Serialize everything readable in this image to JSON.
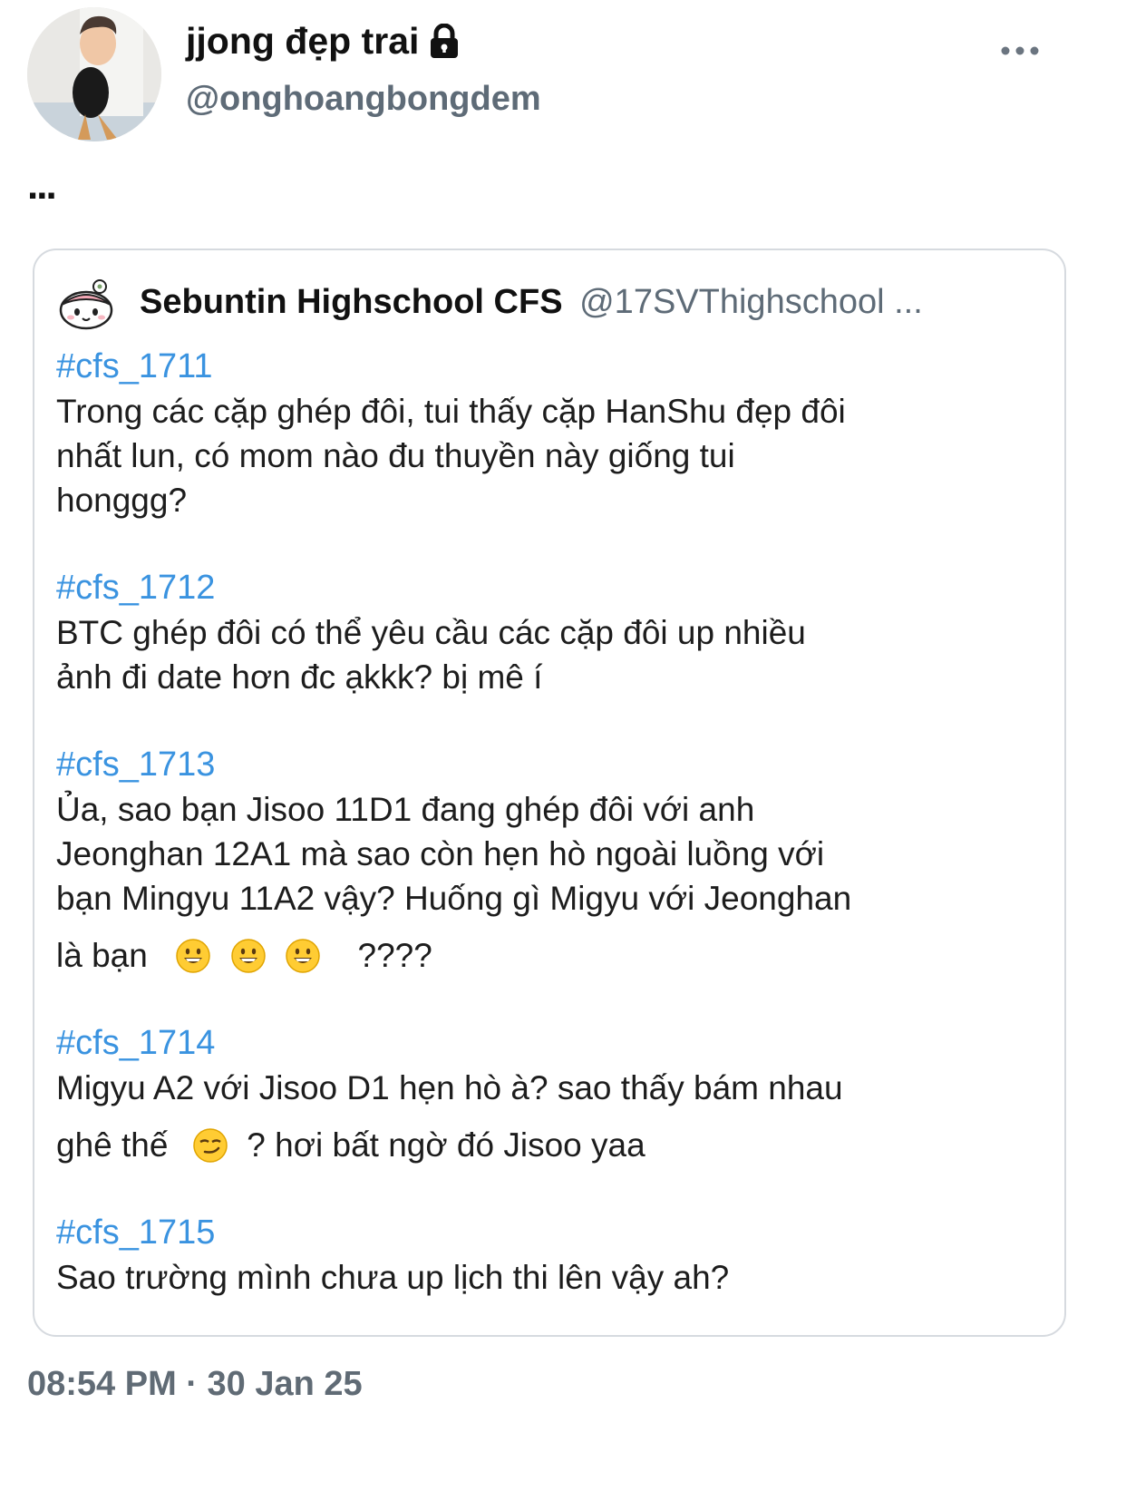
{
  "tweet": {
    "display_name": "jjong đẹp trai",
    "handle": "@onghoangbongdem",
    "text": "...",
    "timestamp": "08:54 PM · 30 Jan 25",
    "avatar_icon": "profile-photo-icon",
    "lock_icon": "lock-icon",
    "more_icon": "more-dots-icon"
  },
  "quote": {
    "display_name": "Sebuntin Highschool CFS",
    "handle": "@17SVThighschool ...",
    "avatar_icon": "cartoon-face-icon",
    "entries": [
      {
        "tag": "#cfs_1711",
        "lines": [
          "Trong các cặp ghép đôi, tui thấy cặp HanShu đẹp đôi",
          "nhất lun, có mom nào đu thuyền này giống tui",
          "honggg?"
        ]
      },
      {
        "tag": "#cfs_1712",
        "lines": [
          "BTC ghép đôi có thể yêu cầu các cặp đôi up nhiều",
          "ảnh đi date hơn đc ạkkk? bị mê í"
        ]
      },
      {
        "tag": "#cfs_1713",
        "lines": [
          "Ủa, sao bạn Jisoo 11D1 đang ghép đôi với anh",
          "Jeonghan 12A1 mà sao còn hẹn hò ngoài luồng với",
          "bạn Mingyu 11A2 vậy? Huống gì Migyu với Jeonghan"
        ],
        "last_prefix": "là bạn",
        "last_suffix": "????"
      },
      {
        "tag": "#cfs_1714",
        "lines": [
          "Migyu A2 với Jisoo D1 hẹn hò à? sao thấy bám nhau"
        ],
        "last_prefix": "ghê thế",
        "last_suffix": "? hơi bất ngờ đó Jisoo yaa"
      },
      {
        "tag": "#cfs_1715",
        "lines": [
          "Sao trường mình chưa up lịch thi lên vậy ah?"
        ]
      }
    ]
  },
  "colors": {
    "hashtag": "#3a93e0",
    "secondary_text": "#5e6b77",
    "card_border": "#d6dadf"
  }
}
